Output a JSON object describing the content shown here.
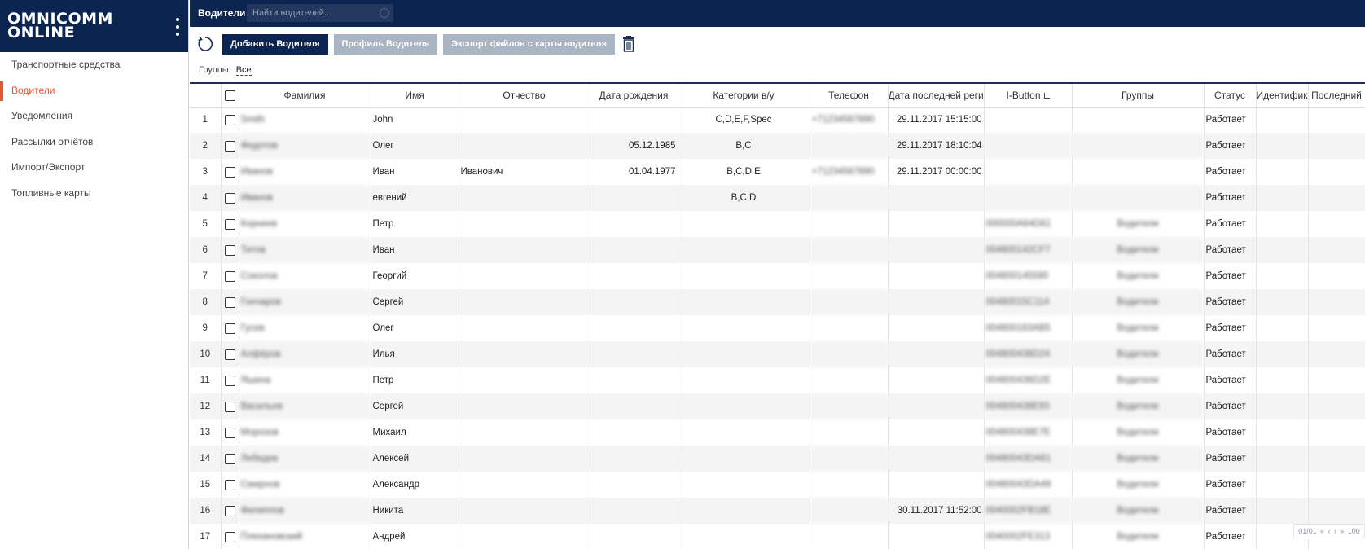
{
  "brand": {
    "line1": "OMNICOMM",
    "line2": "ONLINE"
  },
  "sidebar": {
    "items": [
      {
        "label": "Транспортные средства",
        "active": false
      },
      {
        "label": "Водители",
        "active": true
      },
      {
        "label": "Уведомления",
        "active": false
      },
      {
        "label": "Рассылки отчётов",
        "active": false
      },
      {
        "label": "Импорт/Экспорт",
        "active": false
      },
      {
        "label": "Топливные карты",
        "active": false
      }
    ]
  },
  "header": {
    "title": "Водители",
    "search_placeholder": "Найти водителей..."
  },
  "toolbar": {
    "add_label": "Добавить Водителя",
    "profile_label": "Профиль Водителя",
    "export_label": "Экспорт файлов с карты водителя"
  },
  "filter": {
    "label": "Группы:",
    "value": "Все"
  },
  "table": {
    "columns": [
      "Фамилия",
      "Имя",
      "Отчество",
      "Дата рождения",
      "Категории в/у",
      "Телефон",
      "Дата последней регистр",
      "I-Button",
      "Группы",
      "Статус",
      "Идентифика",
      "Последний"
    ],
    "rows": [
      {
        "n": "1",
        "surname": "Smith",
        "name": "John",
        "patronymic": "",
        "birth": "",
        "cat": "C,D,E,F,Spec",
        "phone": "+71234567890",
        "lastreg": "29.11.2017 15:15:00",
        "ibutton": "",
        "groups": "",
        "status": "Работает"
      },
      {
        "n": "2",
        "surname": "Федотов",
        "name": "Олег",
        "patronymic": "",
        "birth": "05.12.1985",
        "cat": "B,C",
        "phone": "",
        "lastreg": "29.11.2017 18:10:04",
        "ibutton": "",
        "groups": "",
        "status": "Работает"
      },
      {
        "n": "3",
        "surname": "Иванов",
        "name": "Иван",
        "patronymic": "Иванович",
        "birth": "01.04.1977",
        "cat": "B,C,D,E",
        "phone": "+71234567890",
        "lastreg": "29.11.2017 00:00:00",
        "ibutton": "",
        "groups": "",
        "status": "Работает"
      },
      {
        "n": "4",
        "surname": "Иванов",
        "name": "евгений",
        "patronymic": "",
        "birth": "",
        "cat": "B,C,D",
        "phone": "",
        "lastreg": "",
        "ibutton": "",
        "groups": "",
        "status": "Работает"
      },
      {
        "n": "5",
        "surname": "Корнеев",
        "name": "Петр",
        "patronymic": "",
        "birth": "",
        "cat": "",
        "phone": "",
        "lastreg": "",
        "ibutton": "000000A64D61",
        "groups": "Водители",
        "status": "Работает"
      },
      {
        "n": "6",
        "surname": "Титов",
        "name": "Иван",
        "patronymic": "",
        "birth": "",
        "cat": "",
        "phone": "",
        "lastreg": "",
        "ibutton": "004800142CF7",
        "groups": "Водители",
        "status": "Работает"
      },
      {
        "n": "7",
        "surname": "Соколов",
        "name": "Георгий",
        "patronymic": "",
        "birth": "",
        "cat": "",
        "phone": "",
        "lastreg": "",
        "ibutton": "004800145580",
        "groups": "Водители",
        "status": "Работает"
      },
      {
        "n": "8",
        "surname": "Гончаров",
        "name": "Сергей",
        "patronymic": "",
        "birth": "",
        "cat": "",
        "phone": "",
        "lastreg": "",
        "ibutton": "00480015C114",
        "groups": "Водители",
        "status": "Работает"
      },
      {
        "n": "9",
        "surname": "Гусев",
        "name": "Олег",
        "patronymic": "",
        "birth": "",
        "cat": "",
        "phone": "",
        "lastreg": "",
        "ibutton": "004800163AB5",
        "groups": "Водители",
        "status": "Работает"
      },
      {
        "n": "10",
        "surname": "Алфёров",
        "name": "Илья",
        "patronymic": "",
        "birth": "",
        "cat": "",
        "phone": "",
        "lastreg": "",
        "ibutton": "004800436D24",
        "groups": "Водители",
        "status": "Работает"
      },
      {
        "n": "11",
        "surname": "Яшина",
        "name": "Петр",
        "patronymic": "",
        "birth": "",
        "cat": "",
        "phone": "",
        "lastreg": "",
        "ibutton": "004800436D2E",
        "groups": "Водители",
        "status": "Работает"
      },
      {
        "n": "12",
        "surname": "Васильев",
        "name": "Сергей",
        "patronymic": "",
        "birth": "",
        "cat": "",
        "phone": "",
        "lastreg": "",
        "ibutton": "004800438E93",
        "groups": "Водители",
        "status": "Работает"
      },
      {
        "n": "13",
        "surname": "Морозов",
        "name": "Михаил",
        "patronymic": "",
        "birth": "",
        "cat": "",
        "phone": "",
        "lastreg": "",
        "ibutton": "004800438E7E",
        "groups": "Водители",
        "status": "Работает"
      },
      {
        "n": "14",
        "surname": "Лебедев",
        "name": "Алексей",
        "patronymic": "",
        "birth": "",
        "cat": "",
        "phone": "",
        "lastreg": "",
        "ibutton": "00480043DA61",
        "groups": "Водители",
        "status": "Работает"
      },
      {
        "n": "15",
        "surname": "Смирнов",
        "name": "Александр",
        "patronymic": "",
        "birth": "",
        "cat": "",
        "phone": "",
        "lastreg": "",
        "ibutton": "00480043DA49",
        "groups": "Водители",
        "status": "Работает"
      },
      {
        "n": "16",
        "surname": "Филиппов",
        "name": "Никита",
        "patronymic": "",
        "birth": "",
        "cat": "",
        "phone": "",
        "lastreg": "30.11.2017 11:52:00",
        "ibutton": "0040002FB18E",
        "groups": "Водители",
        "status": "Работает"
      },
      {
        "n": "17",
        "surname": "Плехановский",
        "name": "Андрей",
        "patronymic": "",
        "birth": "",
        "cat": "",
        "phone": "",
        "lastreg": "",
        "ibutton": "0040002FE313",
        "groups": "Водители",
        "status": "Работает"
      }
    ]
  },
  "pager": {
    "page": "01/01",
    "size": "100"
  }
}
